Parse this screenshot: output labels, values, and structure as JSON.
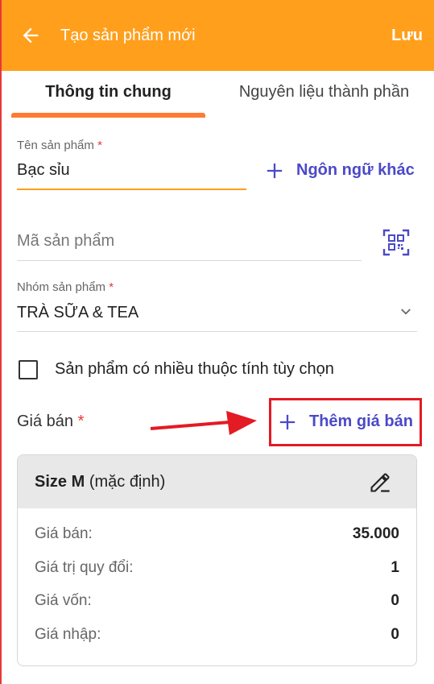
{
  "appbar": {
    "title": "Tạo sản phẩm mới",
    "save_label": "Lưu",
    "background": "#ff9f1c"
  },
  "tabs": [
    {
      "label": "Thông tin chung",
      "active": true
    },
    {
      "label": "Nguyên liệu thành phần",
      "active": false
    }
  ],
  "product_name": {
    "label": "Tên sản phẩm",
    "required_mark": "*",
    "value": "Bạc sỉu",
    "add_language_label": "Ngôn ngữ khác"
  },
  "product_code": {
    "placeholder": "Mã sản phẩm",
    "icon": "qr-code-icon"
  },
  "product_group": {
    "label": "Nhóm sản phẩm",
    "required_mark": "*",
    "value": "TRÀ SỮA & TEA"
  },
  "options_checkbox": {
    "label": "Sản phẩm có nhiều thuộc tính tùy chọn",
    "checked": false
  },
  "price": {
    "label": "Giá bán",
    "required_mark": "*",
    "add_label": "Thêm giá bán"
  },
  "price_card": {
    "name": "Size M",
    "default_note": "(mặc định)",
    "rows": [
      {
        "label": "Giá bán:",
        "value": "35.000"
      },
      {
        "label": "Giá trị quy đổi:",
        "value": "1"
      },
      {
        "label": "Giá vốn:",
        "value": "0"
      },
      {
        "label": "Giá nhập:",
        "value": "0"
      }
    ]
  },
  "colors": {
    "accent": "#ff9f1c",
    "link": "#4b49c8",
    "required": "#e53935",
    "annotation": "#e31b23"
  }
}
